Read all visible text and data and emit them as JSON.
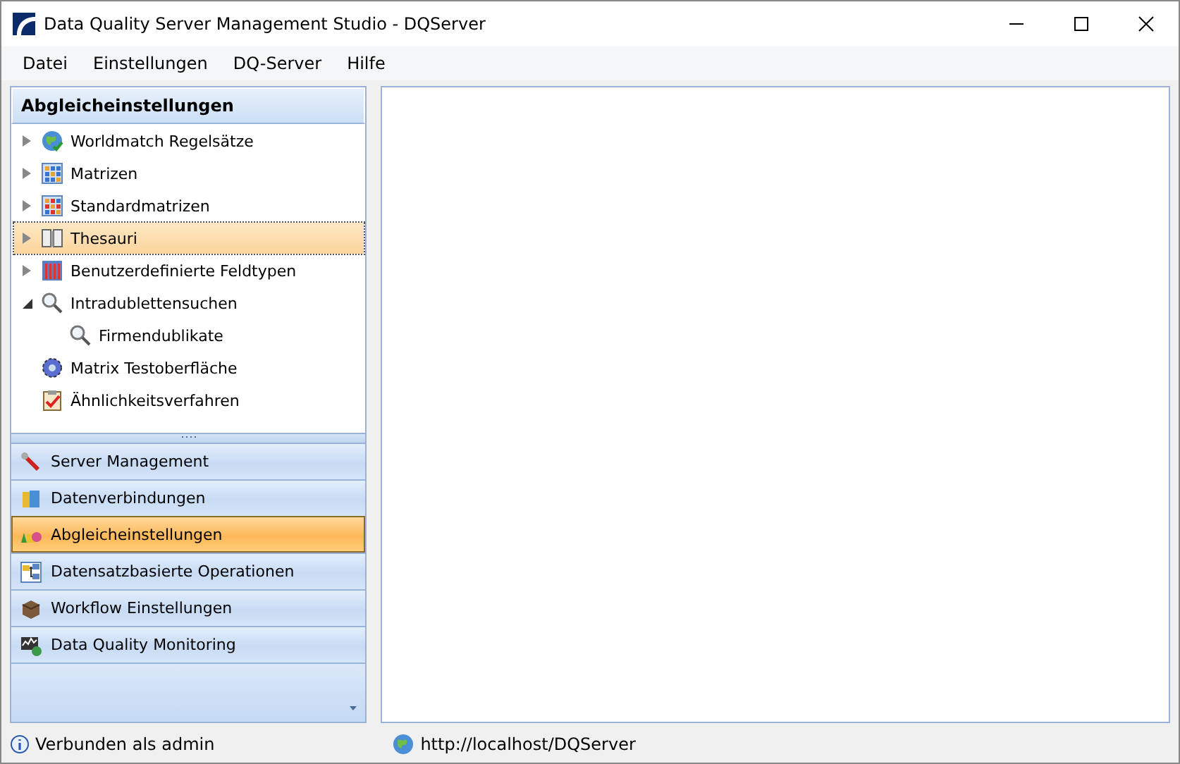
{
  "window": {
    "title": "Data Quality Server Management Studio - DQServer"
  },
  "menu": [
    "Datei",
    "Einstellungen",
    "DQ-Server",
    "Hilfe"
  ],
  "panel": {
    "title": "Abgleicheinstellungen",
    "tree": [
      {
        "label": "Worldmatch Regelsätze",
        "kind": "globe",
        "expanded": false,
        "selected": false
      },
      {
        "label": "Matrizen",
        "kind": "matrix",
        "expanded": false,
        "selected": false
      },
      {
        "label": "Standardmatrizen",
        "kind": "matrix-red",
        "expanded": false,
        "selected": false
      },
      {
        "label": "Thesauri",
        "kind": "book",
        "expanded": false,
        "selected": true
      },
      {
        "label": "Benutzerdefinierte Feldtypen",
        "kind": "columns",
        "expanded": false,
        "selected": false
      },
      {
        "label": "Intradublettensuchen",
        "kind": "magnifier",
        "expanded": true,
        "selected": false,
        "children": [
          {
            "label": "Firmendublikate",
            "kind": "magnifier",
            "selected": false
          }
        ]
      },
      {
        "label": "Matrix Testoberfläche",
        "kind": "gear",
        "selected": false
      },
      {
        "label": "Ähnlichkeitsverfahren",
        "kind": "clipboard",
        "selected": false
      }
    ]
  },
  "nav": [
    {
      "label": "Server Management",
      "kind": "wrench",
      "selected": false
    },
    {
      "label": "Datenverbindungen",
      "kind": "database",
      "selected": false
    },
    {
      "label": "Abgleicheinstellungen",
      "kind": "shapes",
      "selected": true
    },
    {
      "label": "Datensatzbasierte Operationen",
      "kind": "diagram",
      "selected": false
    },
    {
      "label": "Workflow Einstellungen",
      "kind": "box",
      "selected": false
    },
    {
      "label": "Data Quality Monitoring",
      "kind": "monitor",
      "selected": false
    }
  ],
  "status_bar": {
    "user": "Verbunden als admin",
    "url": "http://localhost/DQServer"
  }
}
